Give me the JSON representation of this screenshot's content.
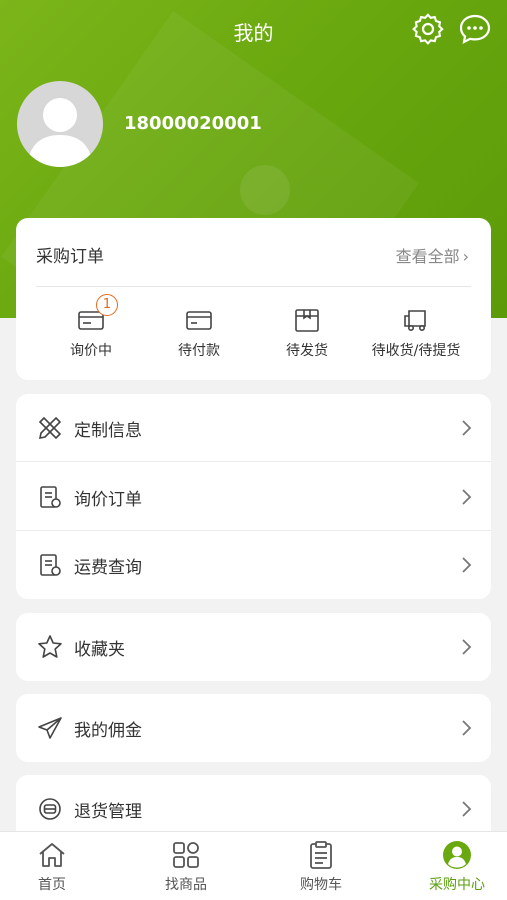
{
  "header": {
    "title": "我的"
  },
  "profile": {
    "phone": "18000020001"
  },
  "orders": {
    "title": "采购订单",
    "view_all": "查看全部",
    "items": [
      {
        "label": "询价中",
        "badge": "1"
      },
      {
        "label": "待付款"
      },
      {
        "label": "待发货"
      },
      {
        "label": "待收货/待提货"
      }
    ]
  },
  "menu": {
    "group1": [
      "定制信息",
      "询价订单",
      "运费查询"
    ],
    "favorites": "收藏夹",
    "commission": "我的佣金",
    "returns": "退货管理"
  },
  "tabbar": {
    "items": [
      {
        "label": "首页"
      },
      {
        "label": "找商品"
      },
      {
        "label": "购物车"
      },
      {
        "label": "采购中心"
      }
    ]
  },
  "colors": {
    "accent": "#6aa80f",
    "badge": "#e26b1f",
    "active_tab": "#5b9e0f"
  }
}
